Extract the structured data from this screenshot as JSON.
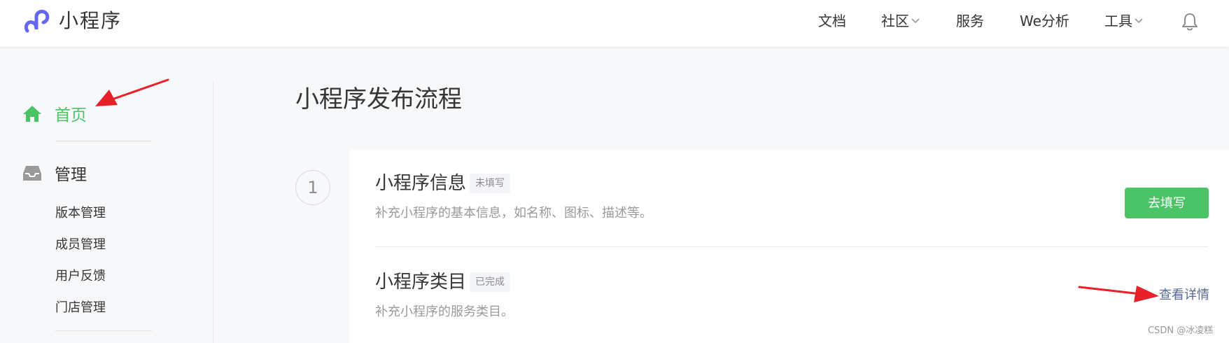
{
  "header": {
    "brand": "小程序",
    "nav": [
      {
        "label": "文档"
      },
      {
        "label": "社区"
      },
      {
        "label": "服务"
      },
      {
        "label": "We分析"
      },
      {
        "label": "工具"
      }
    ]
  },
  "sidebar": {
    "home_label": "首页",
    "manage_label": "管理",
    "sub_items": [
      {
        "label": "版本管理"
      },
      {
        "label": "成员管理"
      },
      {
        "label": "用户反馈"
      },
      {
        "label": "门店管理"
      }
    ]
  },
  "main": {
    "title": "小程序发布流程",
    "step_number": "1",
    "rows": [
      {
        "title": "小程序信息",
        "status": "未填写",
        "desc": "补充小程序的基本信息，如名称、图标、描述等。",
        "action": "去填写"
      },
      {
        "title": "小程序类目",
        "status": "已完成",
        "desc": "补充小程序的服务类目。",
        "action": "查看详情"
      }
    ]
  },
  "watermark": "CSDN @冰凌糕",
  "colors": {
    "accent_green": "#4bc468",
    "link_blue": "#576b95",
    "annotation_red": "#e8202a",
    "logo_purple": "#6467f0"
  }
}
